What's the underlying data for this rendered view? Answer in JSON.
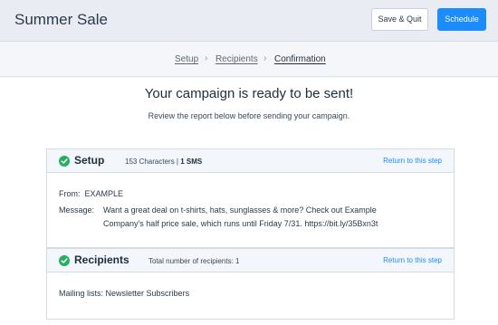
{
  "header": {
    "title": "Summer Sale",
    "save_quit_label": "Save & Quit",
    "schedule_label": "Schedule",
    "accent_color": "#1a8cff"
  },
  "steps": [
    {
      "label": "Setup"
    },
    {
      "label": "Recipients"
    },
    {
      "label": "Confirmation"
    }
  ],
  "main": {
    "headline": "Your campaign is ready to be sent!",
    "subline": "Review the report below before sending your campaign."
  },
  "setup": {
    "title": "Setup",
    "meta_count": "153 Characters | ",
    "meta_sms": "1 SMS",
    "return_link": "Return to this step",
    "from_label": "From:",
    "from_value": "EXAMPLE",
    "message_label": "Message:",
    "message_line1": "Want a great deal on t-shirts, hats, sunglasses & more? Check out Example",
    "message_line2": "Company's half price sale, which runs until Friday 7/31. https://bit.ly/35Bxn3t"
  },
  "recipients": {
    "title": "Recipients",
    "meta": "Total number of recipients: 1",
    "return_link": "Return to this step",
    "lists_label": "Mailing lists:",
    "lists_value": "Newsletter Subscribers"
  },
  "icons": {
    "check": "check-circle-icon",
    "chevron": "chevron-right-icon"
  },
  "colors": {
    "success": "#27ae60",
    "link": "#1a8cff"
  }
}
